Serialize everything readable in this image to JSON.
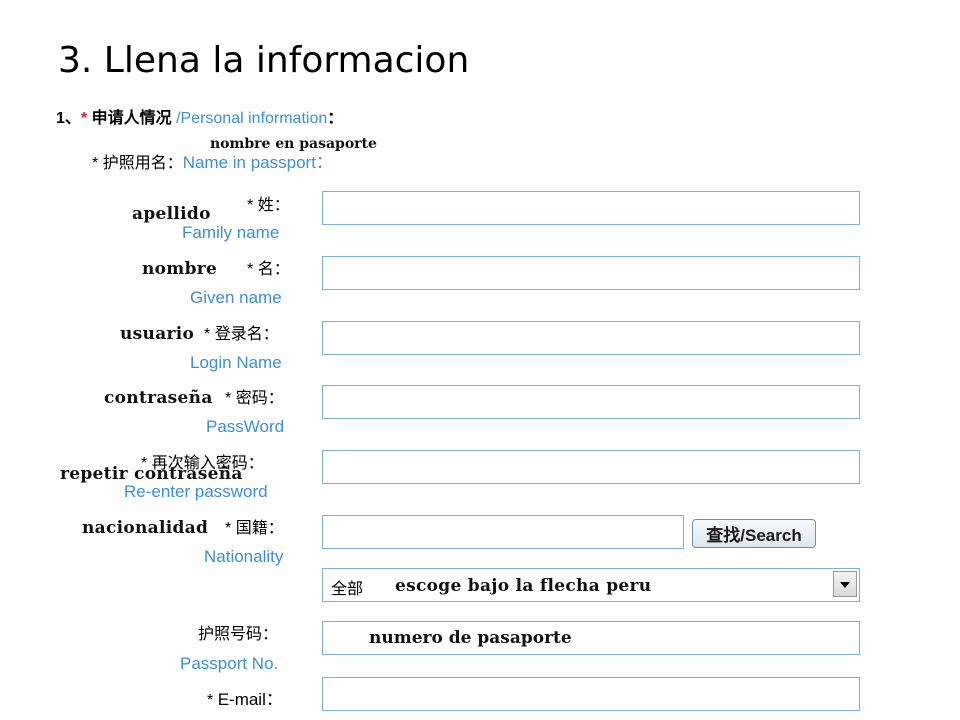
{
  "slide": {
    "title": "3. Llena la informacion"
  },
  "section": {
    "number": "1、",
    "star": "*",
    "cn": "申请人情况",
    "en": "/Personal information",
    "colon": "："
  },
  "name_group": {
    "star": "*",
    "cn": "护照用名：",
    "en": "Name in passport：",
    "note": "nombre en pasaporte"
  },
  "fields": {
    "family_name": {
      "star": "*",
      "cn": "姓：",
      "en": "Family name",
      "note": "apellido",
      "value": ""
    },
    "given_name": {
      "star": "*",
      "cn": "名：",
      "en": "Given name",
      "note": "nombre",
      "value": ""
    },
    "login_name": {
      "star": "*",
      "cn": "登录名：",
      "en": "Login Name",
      "note": "usuario",
      "value": ""
    },
    "password": {
      "star": "*",
      "cn": "密码：",
      "en": "PassWord",
      "note": "contraseña",
      "value": ""
    },
    "reenter_password": {
      "star": "*",
      "cn": "再次输入密码：",
      "en": "Re-enter password",
      "note": "repetir contraseña",
      "value": ""
    },
    "nationality": {
      "star": "*",
      "cn": "国籍：",
      "en": "Nationality",
      "note": "nacionalidad",
      "value": ""
    },
    "passport_no": {
      "cn": "护照号码：",
      "en": "Passport No.",
      "value": "numero de pasaporte"
    },
    "email": {
      "star": "*",
      "en": "E-mail：",
      "value": ""
    }
  },
  "search_button": {
    "label": "查找/Search"
  },
  "nationality_select": {
    "selected": "全部",
    "note": "escoge bajo la flecha peru"
  },
  "icons": {
    "dropdown": "chevron-down-icon"
  },
  "colors": {
    "accent_blue": "#3d8fd6",
    "required_red": "#e02020",
    "field_border": "#7fb0dc"
  }
}
